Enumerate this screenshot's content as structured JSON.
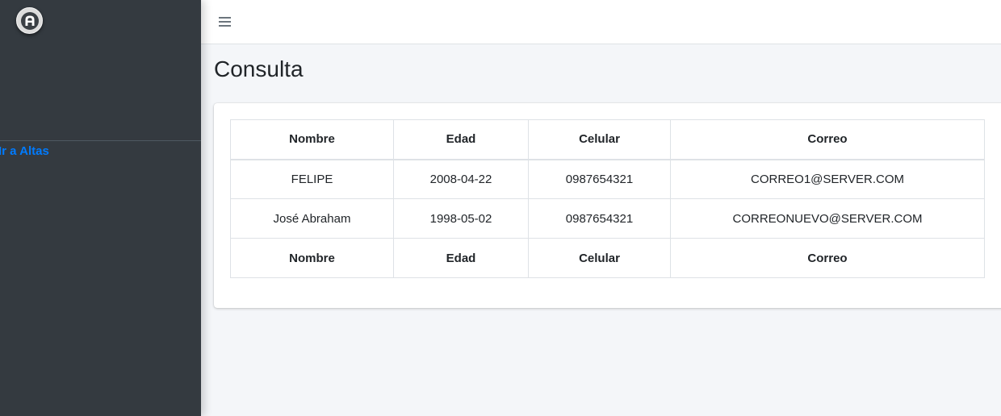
{
  "sidebar": {
    "logo_icon": "a-letter-logo-icon",
    "nav_link": "Ir a Altas"
  },
  "topbar": {
    "menu_icon": "hamburger-menu-icon"
  },
  "main": {
    "title": "Consulta",
    "table": {
      "headers": [
        "Nombre",
        "Edad",
        "Celular",
        "Correo"
      ],
      "rows": [
        [
          "FELIPE",
          "2008-04-22",
          "0987654321",
          "CORREO1@SERVER.COM"
        ],
        [
          "José Abraham",
          "1998-05-02",
          "0987654321",
          "CORREONUEVO@SERVER.COM"
        ]
      ],
      "footers": [
        "Nombre",
        "Edad",
        "Celular",
        "Correo"
      ]
    }
  },
  "colors": {
    "sidebar_bg": "#343a40",
    "link": "#007bff",
    "page_bg": "#f4f6f9"
  }
}
